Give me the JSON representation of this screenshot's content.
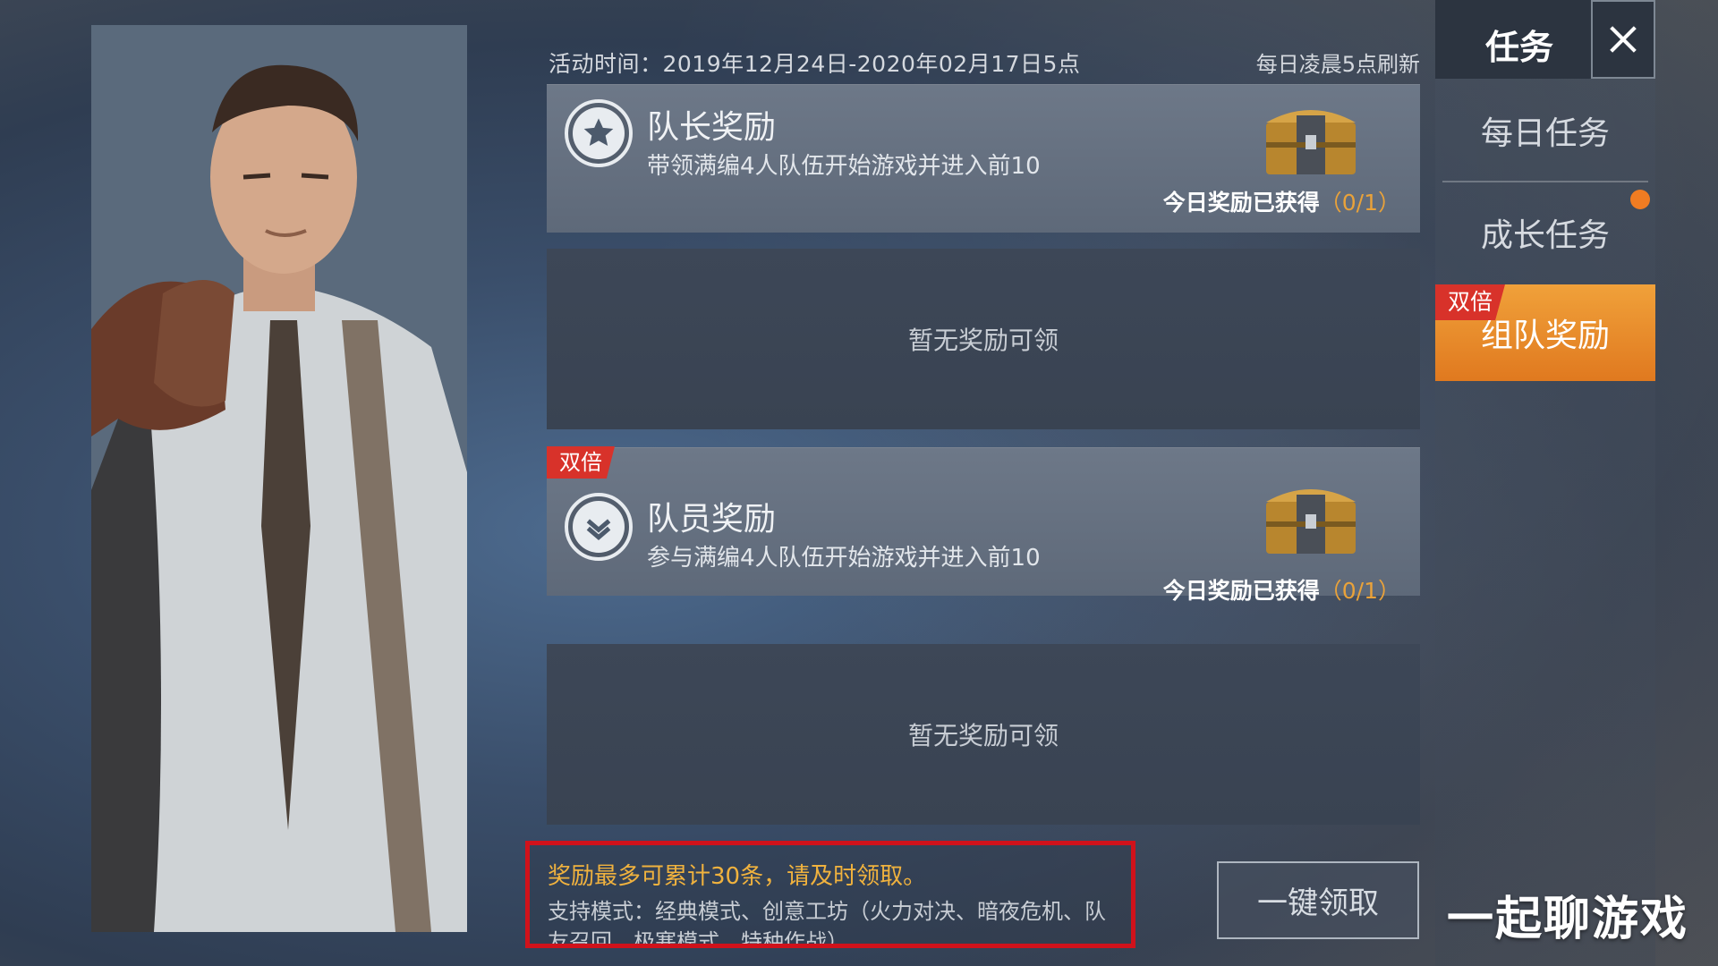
{
  "header": {
    "activity_time": "活动时间：2019年12月24日-2020年02月17日5点",
    "refresh_note": "每日凌晨5点刷新"
  },
  "rewards": [
    {
      "title": "队长奖励",
      "desc": "带领满编4人队伍开始游戏并进入前10",
      "obtained_label": "今日奖励已获得",
      "obtained_count": "（0/1）",
      "double": "",
      "emblem_icon": "star-icon"
    },
    {
      "title": "队员奖励",
      "desc": "参与满编4人队伍开始游戏并进入前10",
      "obtained_label": "今日奖励已获得",
      "obtained_count": "（0/1）",
      "double": "双倍",
      "emblem_icon": "chevron-badge-icon"
    }
  ],
  "empty_panels": [
    "暂无奖励可领",
    "暂无奖励可领"
  ],
  "notice": {
    "line1": "奖励最多可累计30条，请及时领取。",
    "line2": "支持模式：经典模式、创意工坊（火力对决、暗夜危机、队友召回、极寒模式、特种作战）"
  },
  "claim_all": "一键领取",
  "watermark": "一起聊游戏",
  "sidebar": {
    "title": "任务",
    "tabs": [
      "每日任务",
      "成长任务",
      "组队奖励"
    ],
    "active_double": "双倍"
  },
  "colors": {
    "accent_orange": "#e0791f",
    "double_red": "#d8322a",
    "count_gold": "#e9a23a",
    "notice_border": "#d0121b"
  }
}
